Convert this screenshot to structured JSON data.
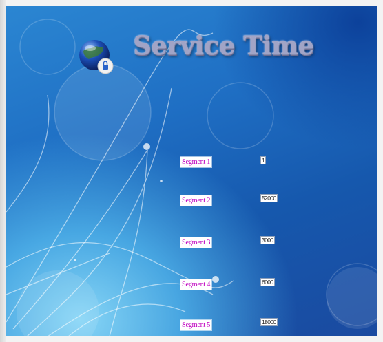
{
  "header": {
    "title": "Service Time",
    "logo_icon": "globe-lock-icon"
  },
  "segments": [
    {
      "label": "Segment 1",
      "value": "1"
    },
    {
      "label": "Segment 2",
      "value": "52000"
    },
    {
      "label": "Segment 3",
      "value": "3000"
    },
    {
      "label": "Segment 4",
      "value": "6000"
    },
    {
      "label": "Segment 5",
      "value": "18000"
    }
  ],
  "colors": {
    "background": "#1f6fc4",
    "label_text": "#c000c0",
    "title": "#a1a4c6"
  }
}
